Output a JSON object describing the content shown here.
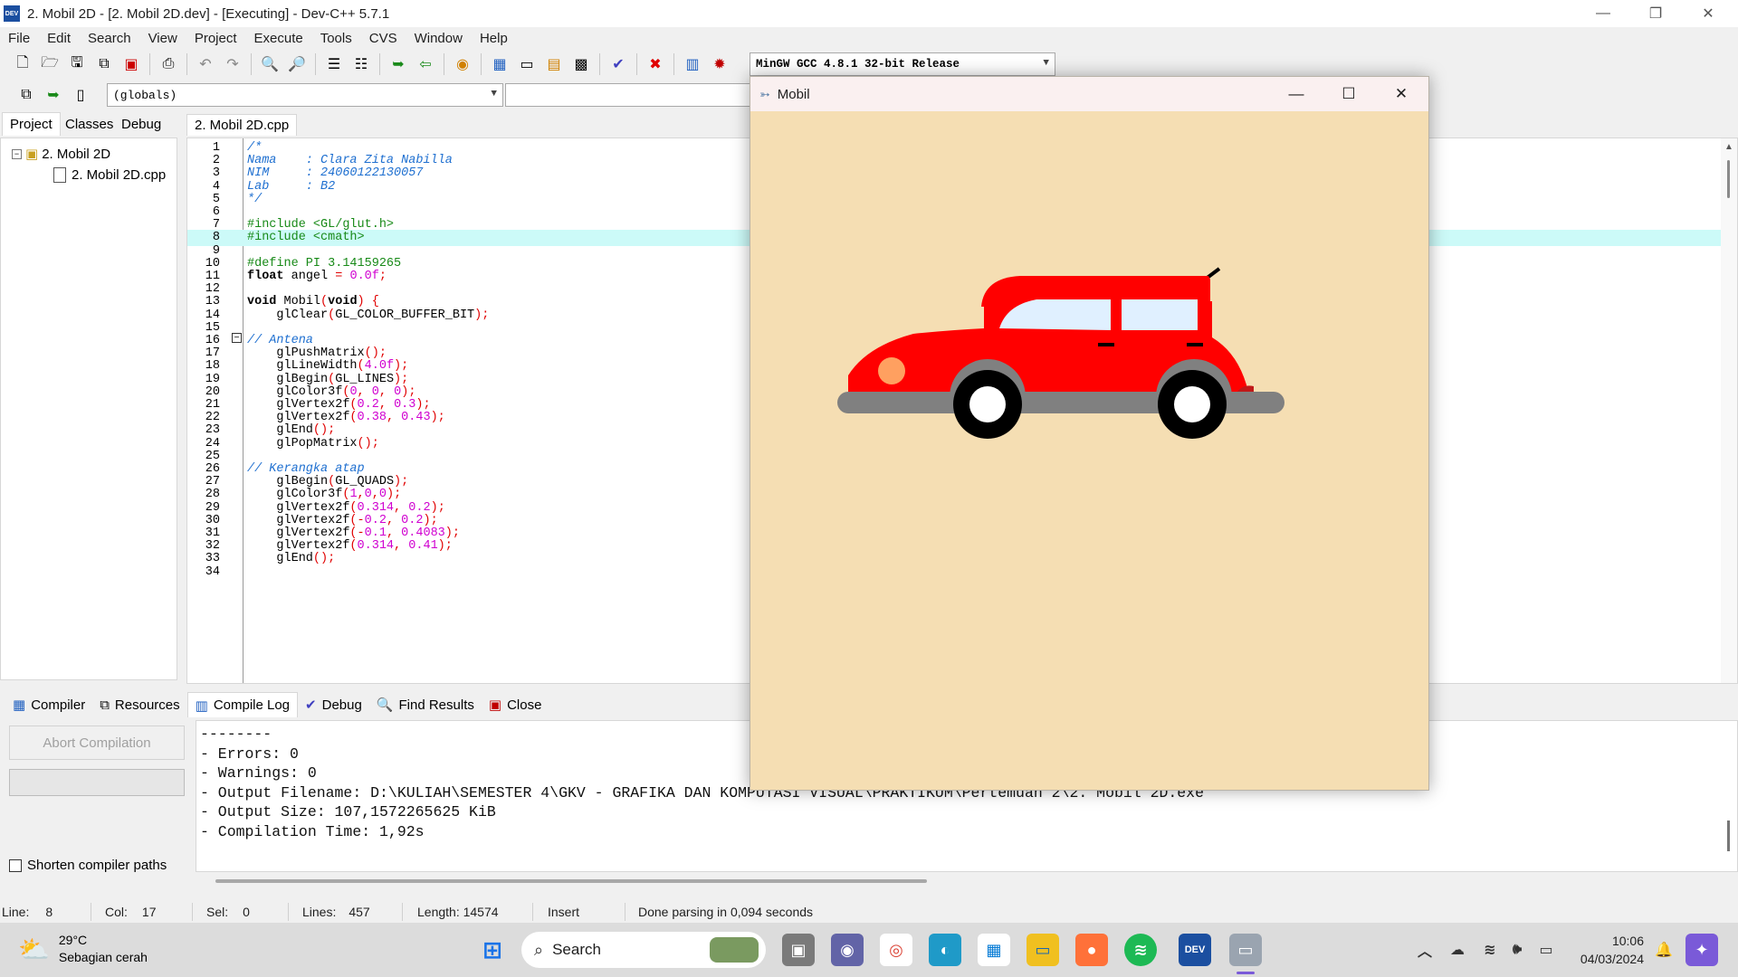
{
  "ide": {
    "title": "2. Mobil 2D - [2. Mobil 2D.dev] - [Executing] - Dev-C++ 5.7.1",
    "app_icon_text": "DEV",
    "menu": [
      "File",
      "Edit",
      "Search",
      "View",
      "Project",
      "Execute",
      "Tools",
      "CVS",
      "Window",
      "Help"
    ],
    "compiler_select": "MinGW GCC 4.8.1 32-bit Release",
    "scope_select": "(globals)",
    "left_tabs": [
      "Project",
      "Classes",
      "Debug"
    ],
    "tree": {
      "project": "2. Mobil 2D",
      "file": "2. Mobil 2D.cpp"
    },
    "editor_tab": "2. Mobil 2D.cpp"
  },
  "code": [
    {
      "n": "1",
      "t": "/*"
    },
    {
      "n": "2",
      "t": "Nama    : Clara Zita Nabilla"
    },
    {
      "n": "3",
      "t": "NIM     : 24060122130057"
    },
    {
      "n": "4",
      "t": "Lab     : B2"
    },
    {
      "n": "5",
      "t": "*/"
    },
    {
      "n": "6",
      "t": ""
    },
    {
      "n": "7",
      "t": "#include <GL/glut.h>"
    },
    {
      "n": "8",
      "t": "#include <cmath>"
    },
    {
      "n": "9",
      "t": ""
    },
    {
      "n": "10",
      "t": "#define PI 3.14159265"
    },
    {
      "n": "11",
      "t": "float angel = 0.0f;"
    },
    {
      "n": "12",
      "t": ""
    },
    {
      "n": "13",
      "t": "void Mobil(void) {"
    },
    {
      "n": "14",
      "t": "    glClear(GL_COLOR_BUFFER_BIT);"
    },
    {
      "n": "15",
      "t": ""
    },
    {
      "n": "16",
      "t": "// Antena"
    },
    {
      "n": "17",
      "t": "    glPushMatrix();"
    },
    {
      "n": "18",
      "t": "    glLineWidth(4.0f);"
    },
    {
      "n": "19",
      "t": "    glBegin(GL_LINES);"
    },
    {
      "n": "20",
      "t": "    glColor3f(0, 0, 0);"
    },
    {
      "n": "21",
      "t": "    glVertex2f(0.2, 0.3);"
    },
    {
      "n": "22",
      "t": "    glVertex2f(0.38, 0.43);"
    },
    {
      "n": "23",
      "t": "    glEnd();"
    },
    {
      "n": "24",
      "t": "    glPopMatrix();"
    },
    {
      "n": "25",
      "t": ""
    },
    {
      "n": "26",
      "t": "// Kerangka atap"
    },
    {
      "n": "27",
      "t": "    glBegin(GL_QUADS);"
    },
    {
      "n": "28",
      "t": "    glColor3f(1,0,0);"
    },
    {
      "n": "29",
      "t": "    glVertex2f(0.314, 0.2);"
    },
    {
      "n": "30",
      "t": "    glVertex2f(-0.2, 0.2);"
    },
    {
      "n": "31",
      "t": "    glVertex2f(-0.1, 0.4083);"
    },
    {
      "n": "32",
      "t": "    glVertex2f(0.314, 0.41);"
    },
    {
      "n": "33",
      "t": "    glEnd();"
    },
    {
      "n": "34",
      "t": ""
    }
  ],
  "highlighted_line": "8",
  "bottom_tabs": [
    "Compiler",
    "Resources",
    "Compile Log",
    "Debug",
    "Find Results",
    "Close"
  ],
  "bottom": {
    "abort_label": "Abort Compilation",
    "shorten_label": "Shorten compiler paths",
    "log": [
      "--------",
      "- Errors: 0",
      "- Warnings: 0",
      "- Output Filename: D:\\KULIAH\\SEMESTER 4\\GKV - GRAFIKA DAN KOMPUTASI VISUAL\\PRAKTIKUM\\Pertemuan 2\\2. Mobil 2D.exe",
      "- Output Size: 107,1572265625 KiB",
      "- Compilation Time: 1,92s"
    ]
  },
  "status": {
    "line_label": "Line:",
    "line_val": "8",
    "col_label": "Col:",
    "col_val": "17",
    "sel_label": "Sel:",
    "sel_val": "0",
    "lines_label": "Lines:",
    "lines_val": "457",
    "length_label": "Length: 14574",
    "mode": "Insert",
    "message": "Done parsing in 0,094 seconds"
  },
  "mobil_window": {
    "title": "Mobil",
    "background": "#f5deb3",
    "car_body": "#ff0000",
    "window_glass": "#e0f0ff",
    "road": "#808080",
    "headlight": "#ffa060"
  },
  "taskbar": {
    "temp": "29°C",
    "weather": "Sebagian cerah",
    "search": "Search",
    "time": "10:06",
    "date": "04/03/2024",
    "dev_icon_text": "DEV"
  }
}
